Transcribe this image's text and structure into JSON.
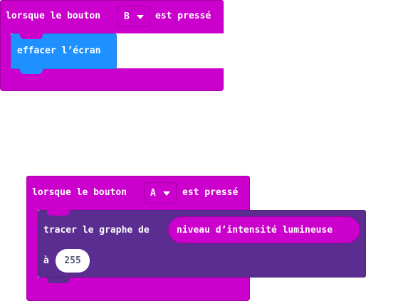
{
  "block_button_b": {
    "prefix": "lorsque le bouton",
    "button_value": "B",
    "suffix": "est pressé",
    "statement": "effacer l’écran"
  },
  "block_button_a": {
    "prefix": "lorsque le bouton",
    "button_value": "A",
    "suffix": "est pressé",
    "statement_prefix": "tracer le graphe de",
    "reporter": "niveau d’intensité lumineuse",
    "max_label": "à",
    "max_value": "255"
  },
  "colors": {
    "input_category": "#cc00cc",
    "basic_category": "#1e90ff",
    "led_category": "#5c2d91"
  }
}
